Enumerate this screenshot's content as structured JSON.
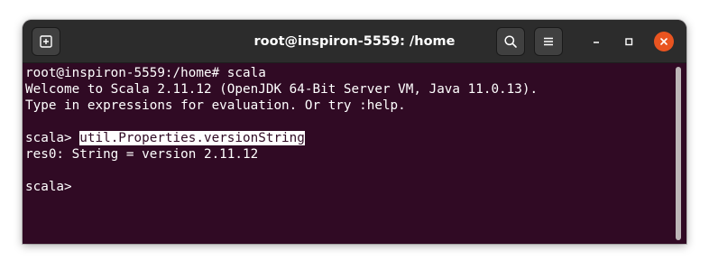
{
  "window": {
    "title": "root@inspiron-5559: /home"
  },
  "titlebar": {
    "new_tab_icon": "new-tab-icon",
    "search_icon": "search-icon",
    "menu_icon": "hamburger-menu-icon",
    "minimize_icon": "minimize-icon",
    "maximize_icon": "maximize-icon",
    "close_icon": "close-icon"
  },
  "terminal": {
    "lines": [
      "root@inspiron-5559:/home# scala",
      "Welcome to Scala 2.11.12 (OpenJDK 64-Bit Server VM, Java 11.0.13).",
      "Type in expressions for evaluation. Or try :help.",
      "",
      "scala> ",
      "res0: String = version 2.11.12",
      "",
      "scala>"
    ],
    "selected_text": "util.Properties.versionString"
  },
  "colors": {
    "terminal_bg": "#300a24",
    "titlebar_bg": "#2c2c2c",
    "close_accent": "#e95420",
    "text": "#ffffff"
  }
}
